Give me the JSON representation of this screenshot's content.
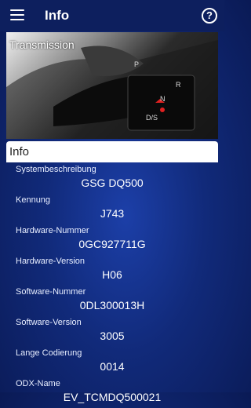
{
  "appbar": {
    "title": "Info",
    "menu_icon": "hamburger-menu-icon",
    "help_icon": "help-circle-icon",
    "help_glyph": "?"
  },
  "hero": {
    "title": "Transmission",
    "gear_labels": [
      "P",
      "R",
      "N",
      "D/S"
    ]
  },
  "info_panel": {
    "header": "Info",
    "rows": [
      {
        "label": "Systembeschreibung",
        "value": "GSG DQ500"
      },
      {
        "label": "Kennung",
        "value": "J743"
      },
      {
        "label": "Hardware-Nummer",
        "value": "0GC927711G"
      },
      {
        "label": "Hardware-Version",
        "value": "H06"
      },
      {
        "label": "Software-Nummer",
        "value": "0DL300013H"
      },
      {
        "label": "Software-Version",
        "value": "3005"
      },
      {
        "label": "Lange Codierung",
        "value": "0014"
      },
      {
        "label": "ODX-Name",
        "value": "EV_TCMDQ500021"
      }
    ]
  }
}
